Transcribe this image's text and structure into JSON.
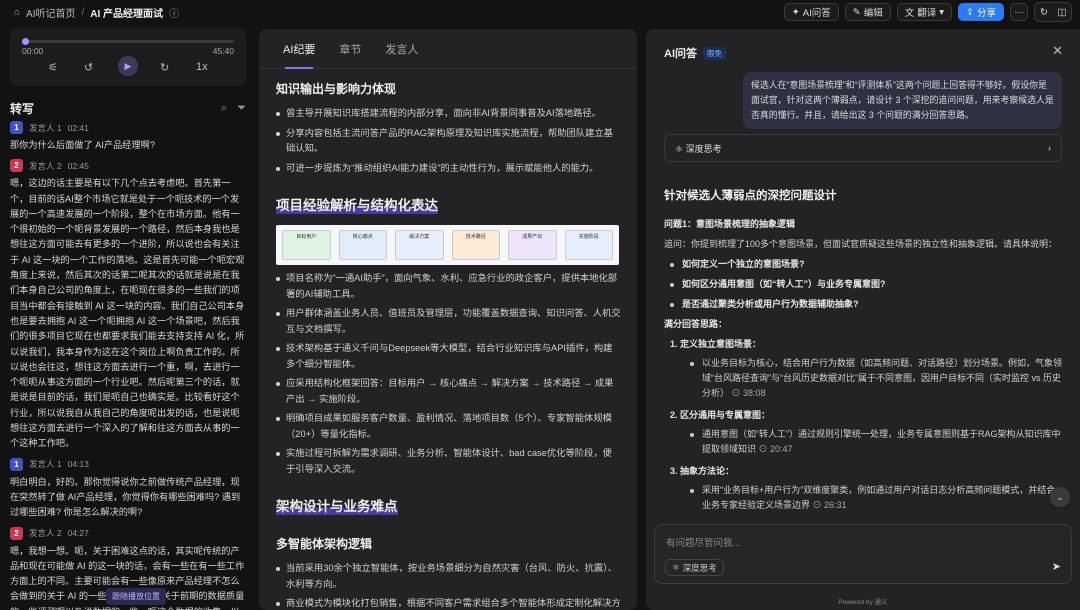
{
  "topbar": {
    "home_label": "AI听记首页",
    "separator": "/",
    "title": "AI 产品经理面试",
    "buttons": {
      "ai_qa": "AI问答",
      "edit": "编辑",
      "translate": "翻译",
      "share": "分享"
    }
  },
  "player": {
    "current_time": "00:00",
    "total_time": "45:40",
    "progress_fraction": 0.0,
    "speed": "1x"
  },
  "transcript": {
    "title": "转写",
    "follow_label": "跟随播放位置",
    "segments": [
      {
        "badge": "1",
        "speaker": "发言人 1",
        "time": "02:41",
        "text": "那你为什么后面做了 AI产品经理啊?"
      },
      {
        "badge": "2",
        "speaker": "发言人 2",
        "time": "02:45",
        "text": "嗯，这边的话主要是有以下几个点去考虑吧。首先第一个，目前的话AI整个市场它就是处于一个呃技术的一个发展的一个高速发展的一个阶段，整个在市场方面。他有一个很初始的一个呃背景发展的一个路径，然后本身我也是想往这方面可能去有更多的一个进阶，所以说也会有关注于 AI 这一块的一个工作的落地。这是首先可能一个呃宏观角度上来说，然后其次的话第二呢其次的话就是说是在我们本身自己公司的角度上，在呃现在很多的一些我们的项目当中都会有接触到 AI 这一块的内容。我们自己公司本身也是要去拥抱 AI 这一个呃拥抱 AI 这一个场景吧，然后我们的很多项目它现在也都要求我们能去支持支持 AI 化，所以说我们，我本身作为这在这个岗位上啊负责工作的。所以说也会往这，想往这方面去进行一个重，啊，去进行一个呃呃从事这方面的一个行业吧。然后呢第三个的话，就是说是目前的话，我们是呃自己也确实是。比较看好这个行业，所以说我自从我自己的角度呢出发的话，也是说呃想往这方面去进行一个深入的了解和往这方面去从事的一个这种工作吧。"
      },
      {
        "badge": "1",
        "speaker": "发言人 1",
        "time": "04:13",
        "text": "明白明白，好的。那你觉得说你之前做传统产品经理，现在突然转了做 AI产品经理，你觉得你有哪些困难吗? 遇到过哪些困难? 你是怎么解决的啊?"
      },
      {
        "badge": "2",
        "speaker": "发言人 2",
        "time": "04:27",
        "text": "嗯，我想一想。呃，关于困难这点的话，其实呢传统的产品和现在可能做 AI 的这一块的话，会有一些在有一些工作方面上的不同。主要可能会有一些像原来产品经理不怎么会做到的关于 AI 的一些评测啊，然后关于前期的数据质量的一些评测啊以及说数据的一些，呃这个数据的收集，以及说一"
      }
    ]
  },
  "summary": {
    "tabs": [
      "AI纪要",
      "章节",
      "发言人"
    ],
    "section1_title": "知识输出与影响力体现",
    "section1_bullets": [
      "曾主导开展知识库搭建流程的内部分享，面向非AI背景同事普及AI落地路径。",
      "分享内容包括主流问答产品的RAG架构原理及知识库实施流程，帮助团队建立基础认知。",
      "可进一步提炼为“推动组织AI能力建设”的主动性行为，展示赋能他人的能力。"
    ],
    "section2_title": "项目经验解析与结构化表达",
    "flow_chart": {
      "steps": [
        "目标用户",
        "核心痛点",
        "解决方案",
        "技术路径",
        "成果产出",
        "实施阶段"
      ],
      "colors": [
        "#dff3e4",
        "#e3ecfb",
        "#e6edfb",
        "#fde9d7",
        "#efe5fb",
        "#e6edfb"
      ]
    },
    "section2_bullets": [
      "项目名称为“一通AI助手”，面向气象、水利、应急行业的政企客户，提供本地化部署的AI辅助工具。",
      "用户群体涵盖业务人员、值班员及管理层，功能覆盖数据查询、知识问答、人机交互与文档撰写。",
      "技术架构基于通义千问与Deepseek等大模型，结合行业知识库与API插件，构建多个细分智能体。",
      "应采用结构化框架回答：目标用户 → 核心痛点 → 解决方案 → 技术路径 → 成果产出 → 实施阶段。",
      "明确项目成果如服务客户数量、盈利情况、落地项目数（5个）、专家智能体规模（20+）等量化指标。",
      "实施过程可拆解为需求调研、业务分析、智能体设计、bad case优化等阶段，便于引导深入交流。"
    ],
    "section3_title": "架构设计与业务难点",
    "section4_title": "多智能体架构逻辑",
    "section4_bullets": [
      "当前采用30余个独立智能体，按业务场景细分为自然灾害（台风、防火、抗震）、水利等方向。",
      "商业模式为模块化打包销售，根据不同客户需求组合多个智能体形成定制化解决方案。"
    ]
  },
  "qa": {
    "title": "AI问答",
    "badge": "限免",
    "question": "候选人在“意图场景梳理”和“评测体系”这两个问题上回答得不够好。假设你是面试官，针对这两个薄弱点，请设计 3 个深挖的追问问题，用来考察候选人是否真的懂行。并且，请给出这 3 个问题的满分回答思路。",
    "deep_think_label": "深度思考",
    "answer_title": "针对候选人薄弱点的深挖问题设计",
    "q1_title": "问题1：意图场景梳理的抽象逻辑",
    "q1_ask": "追问：你提到梳理了100多个意图场景，但面试官质疑这些场景的独立性和抽象逻辑。请具体说明：",
    "q1_points": [
      "如何定义一个独立的意图场景?",
      "如何区分通用意图（如“转人工”）与业务专属意图?",
      "是否通过聚类分析或用户行为数据辅助抽象?"
    ],
    "full_score_label": "满分回答思路：",
    "answers": [
      {
        "num": "1.",
        "title": "定义独立意图场景：",
        "text": "以业务目标为核心，结合用户行为数据（如高频问题、对话路径）划分场景。例如，气象领域“台风路径查询”与“台风历史数据对比”属于不同意图，因用户目标不同（实时监控 vs 历史分析）",
        "ts": "38:08"
      },
      {
        "num": "2.",
        "title": "区分通用与专属意图：",
        "text": "通用意图（如“转人工”）通过规则引擎统一处理，业务专属意图则基于RAG架构从知识库中提取领域知识",
        "ts": "20:47"
      },
      {
        "num": "3.",
        "title": "抽象方法论：",
        "text": "采用“业务目标+用户行为”双维度聚类，例如通过用户对话日志分析高频问题模式，并结合业务专家经验定义场景边界",
        "ts": "26:31"
      }
    ],
    "input_placeholder": "有问题尽管问我...",
    "input_deep_label": "深度思考",
    "powered": "Powered by 通义"
  }
}
